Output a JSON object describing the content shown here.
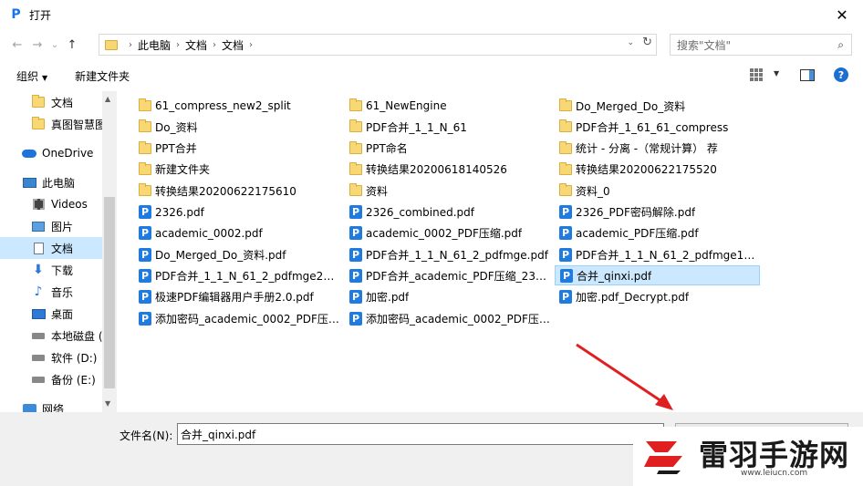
{
  "window": {
    "title": "打开",
    "app_icon": "P",
    "close_glyph": "✕"
  },
  "nav": {
    "back": "←",
    "forward": "→",
    "recent": "⌄",
    "up": "↑"
  },
  "address": {
    "crumbs": [
      "此电脑",
      "文档",
      "文档"
    ],
    "sep": "›",
    "drop": "⌄",
    "refresh": "↻"
  },
  "search": {
    "placeholder": "搜索\"文档\"",
    "icon": "⌕"
  },
  "toolbar": {
    "organize": "组织",
    "organize_caret": "▼",
    "new_folder": "新建文件夹",
    "view_caret": "▼",
    "help": "?"
  },
  "sidebar": {
    "items": [
      {
        "label": "文档",
        "icon": "folder"
      },
      {
        "label": "真图智慧图",
        "icon": "folder"
      },
      {
        "label": "OneDrive",
        "icon": "cloud"
      },
      {
        "label": "此电脑",
        "icon": "pc"
      },
      {
        "label": "Videos",
        "icon": "video"
      },
      {
        "label": "图片",
        "icon": "picture"
      },
      {
        "label": "文档",
        "icon": "document"
      },
      {
        "label": "下载",
        "icon": "download"
      },
      {
        "label": "音乐",
        "icon": "music"
      },
      {
        "label": "桌面",
        "icon": "desktop"
      },
      {
        "label": "本地磁盘 (",
        "icon": "drive"
      },
      {
        "label": "软件 (D:)",
        "icon": "drive"
      },
      {
        "label": "备份 (E:)",
        "icon": "drive"
      },
      {
        "label": "网络",
        "icon": "network"
      }
    ],
    "scroll_up": "▲",
    "scroll_down": "▼"
  },
  "files": [
    {
      "name": "61_compress_new2_split",
      "type": "folder"
    },
    {
      "name": "Do_资料",
      "type": "folder"
    },
    {
      "name": "PPT合并",
      "type": "folder"
    },
    {
      "name": "新建文件夹",
      "type": "folder"
    },
    {
      "name": "转换结果20200622175610",
      "type": "folder"
    },
    {
      "name": "2326.pdf",
      "type": "pdf"
    },
    {
      "name": "academic_0002.pdf",
      "type": "pdf"
    },
    {
      "name": "Do_Merged_Do_资料.pdf",
      "type": "pdf"
    },
    {
      "name": "PDF合并_1_1_N_61_2_pdfmge2_sp...",
      "type": "pdf"
    },
    {
      "name": "极速PDF编辑器用户手册2.0.pdf",
      "type": "pdf"
    },
    {
      "name": "添加密码_academic_0002_PDF压缩...",
      "type": "pdf"
    },
    {
      "name": "61_NewEngine",
      "type": "folder"
    },
    {
      "name": "PDF合并_1_1_N_61",
      "type": "folder"
    },
    {
      "name": "PPT命名",
      "type": "folder"
    },
    {
      "name": "转换结果20200618140526",
      "type": "folder"
    },
    {
      "name": "资料",
      "type": "folder"
    },
    {
      "name": "2326_combined.pdf",
      "type": "pdf"
    },
    {
      "name": "academic_0002_PDF压缩.pdf",
      "type": "pdf"
    },
    {
      "name": "PDF合并_1_1_N_61_2_pdfmge.pdf",
      "type": "pdf"
    },
    {
      "name": "PDF合并_academic_PDF压缩_2326...",
      "type": "pdf"
    },
    {
      "name": "加密.pdf",
      "type": "pdf"
    },
    {
      "name": "添加密码_academic_0002_PDF压缩...",
      "type": "pdf"
    },
    {
      "name": "Do_Merged_Do_资料",
      "type": "folder"
    },
    {
      "name": "PDF合并_1_61_61_compress",
      "type": "folder"
    },
    {
      "name": "统计 - 分离 -（常规计算） 荐",
      "type": "folder"
    },
    {
      "name": "转换结果20200622175520",
      "type": "folder"
    },
    {
      "name": "资料_0",
      "type": "folder"
    },
    {
      "name": "2326_PDF密码解除.pdf",
      "type": "pdf"
    },
    {
      "name": "academic_PDF压缩.pdf",
      "type": "pdf"
    },
    {
      "name": "PDF合并_1_1_N_61_2_pdfmge1_sp...",
      "type": "pdf"
    },
    {
      "name": "合并_qinxi.pdf",
      "type": "pdf",
      "selected": true
    },
    {
      "name": "加密.pdf_Decrypt.pdf",
      "type": "pdf"
    }
  ],
  "filename": {
    "label": "文件名(N):",
    "value": "合并_qinxi.pdf"
  },
  "watermark": {
    "text": "雷羽手游网",
    "url": "www.leiucn.com"
  },
  "colors": {
    "selection": "#cce8ff",
    "accent": "#1a73e8",
    "watermark_red": "#e02020"
  }
}
